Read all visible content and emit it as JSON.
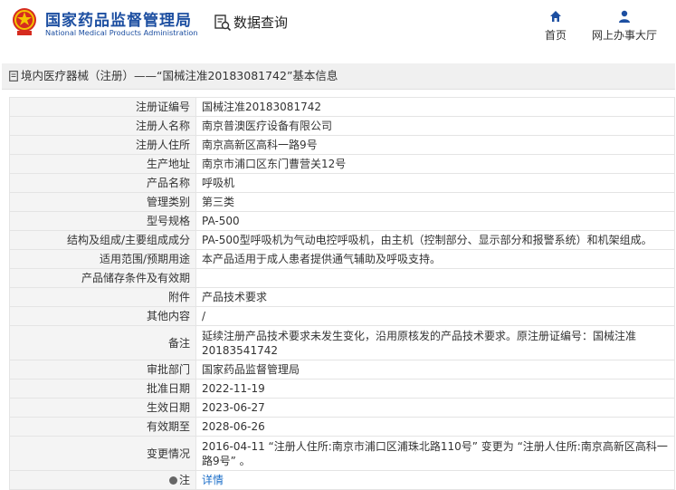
{
  "header": {
    "org_name_cn": "国家药品监督管理局",
    "org_name_en": "National Medical Products Administration",
    "query_label": "数据查询",
    "nav": [
      {
        "label": "首页",
        "icon": "home-icon"
      },
      {
        "label": "网上办事大厅",
        "icon": "user-icon"
      }
    ]
  },
  "breadcrumb": "境内医疗器械（注册）——“国械注准20183081742”基本信息",
  "rows": [
    {
      "label": "注册证编号",
      "value": "国械注准20183081742"
    },
    {
      "label": "注册人名称",
      "value": "南京普澳医疗设备有限公司"
    },
    {
      "label": "注册人住所",
      "value": "南京高新区高科一路9号"
    },
    {
      "label": "生产地址",
      "value": "南京市浦口区东门曹营关12号"
    },
    {
      "label": "产品名称",
      "value": "呼吸机"
    },
    {
      "label": "管理类别",
      "value": "第三类"
    },
    {
      "label": "型号规格",
      "value": "PA-500"
    },
    {
      "label": "结构及组成/主要组成成分",
      "value": "PA-500型呼吸机为气动电控呼吸机，由主机（控制部分、显示部分和报警系统）和机架组成。"
    },
    {
      "label": "适用范围/预期用途",
      "value": "本产品适用于成人患者提供通气辅助及呼吸支持。"
    },
    {
      "label": "产品储存条件及有效期",
      "value": ""
    },
    {
      "label": "附件",
      "value": "产品技术要求"
    },
    {
      "label": "其他内容",
      "value": "/"
    },
    {
      "label": "备注",
      "value": "延续注册产品技术要求未发生变化，沿用原核发的产品技术要求。原注册证编号：国械注准20183541742"
    },
    {
      "label": "审批部门",
      "value": "国家药品监督管理局"
    },
    {
      "label": "批准日期",
      "value": "2022-11-19"
    },
    {
      "label": "生效日期",
      "value": "2023-06-27"
    },
    {
      "label": "有效期至",
      "value": "2028-06-26"
    },
    {
      "label": "变更情况",
      "value": "2016-04-11 “注册人住所:南京市浦口区浦珠北路110号” 变更为 “注册人住所:南京高新区高科一路9号” 。"
    },
    {
      "label": "注",
      "value": "详情"
    }
  ],
  "colors": {
    "brand_blue": "#1d4fa1",
    "link_blue": "#1d6fc9"
  }
}
